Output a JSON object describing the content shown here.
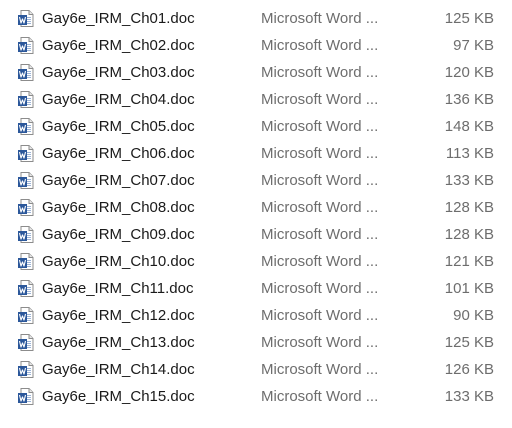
{
  "icon": "word-document-icon",
  "accent": "#2b579a",
  "files": [
    {
      "name": "Gay6e_IRM_Ch01.doc",
      "type": "Microsoft Word ...",
      "size": "125 KB"
    },
    {
      "name": "Gay6e_IRM_Ch02.doc",
      "type": "Microsoft Word ...",
      "size": "97 KB"
    },
    {
      "name": "Gay6e_IRM_Ch03.doc",
      "type": "Microsoft Word ...",
      "size": "120 KB"
    },
    {
      "name": "Gay6e_IRM_Ch04.doc",
      "type": "Microsoft Word ...",
      "size": "136 KB"
    },
    {
      "name": "Gay6e_IRM_Ch05.doc",
      "type": "Microsoft Word ...",
      "size": "148 KB"
    },
    {
      "name": "Gay6e_IRM_Ch06.doc",
      "type": "Microsoft Word ...",
      "size": "113 KB"
    },
    {
      "name": "Gay6e_IRM_Ch07.doc",
      "type": "Microsoft Word ...",
      "size": "133 KB"
    },
    {
      "name": "Gay6e_IRM_Ch08.doc",
      "type": "Microsoft Word ...",
      "size": "128 KB"
    },
    {
      "name": "Gay6e_IRM_Ch09.doc",
      "type": "Microsoft Word ...",
      "size": "128 KB"
    },
    {
      "name": "Gay6e_IRM_Ch10.doc",
      "type": "Microsoft Word ...",
      "size": "121 KB"
    },
    {
      "name": "Gay6e_IRM_Ch11.doc",
      "type": "Microsoft Word ...",
      "size": "101 KB"
    },
    {
      "name": "Gay6e_IRM_Ch12.doc",
      "type": "Microsoft Word ...",
      "size": "90 KB"
    },
    {
      "name": "Gay6e_IRM_Ch13.doc",
      "type": "Microsoft Word ...",
      "size": "125 KB"
    },
    {
      "name": "Gay6e_IRM_Ch14.doc",
      "type": "Microsoft Word ...",
      "size": "126 KB"
    },
    {
      "name": "Gay6e_IRM_Ch15.doc",
      "type": "Microsoft Word ...",
      "size": "133 KB"
    }
  ]
}
